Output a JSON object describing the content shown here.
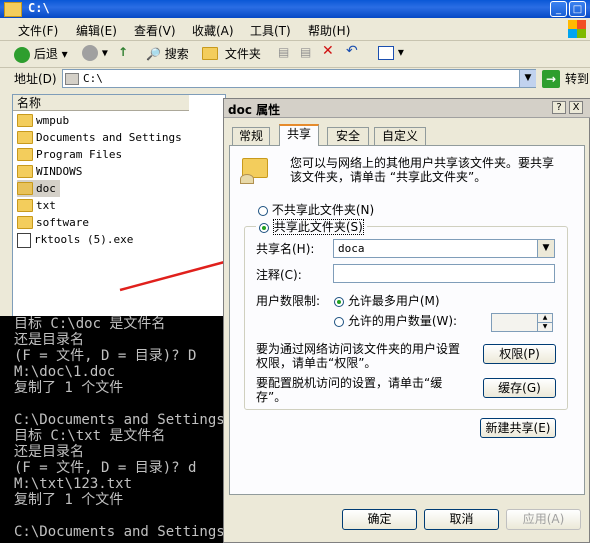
{
  "explorer": {
    "title": "C:\\",
    "menu": [
      "文件(F)",
      "编辑(E)",
      "查看(V)",
      "收藏(A)",
      "工具(T)",
      "帮助(H)"
    ],
    "toolbar": {
      "back": "后退",
      "search": "搜索",
      "folders": "文件夹"
    },
    "address": {
      "label": "地址(D)",
      "value": "C:\\",
      "go": "转到"
    },
    "list_header": "名称",
    "files": [
      "wmpub",
      "Documents and Settings",
      "Program Files",
      "WINDOWS",
      "doc",
      "txt",
      "software",
      "rktools (5).exe"
    ]
  },
  "console": {
    "lines": [
      "目标 C:\\doc 是文件名",
      "还是目录名",
      "(F = 文件, D = 目录)? D",
      "M:\\doc\\1.doc",
      "复制了 1 个文件",
      "",
      "C:\\Documents and Settings\\",
      "目标 C:\\txt 是文件名",
      "还是目录名",
      "(F = 文件, D = 目录)? d",
      "M:\\txt\\123.txt",
      "复制了 1 个文件",
      "",
      "C:\\Documents and Settings\\"
    ]
  },
  "dialog": {
    "title": "doc 属性",
    "help": "?",
    "close": "X",
    "tabs": [
      "常规",
      "共享",
      "安全",
      "自定义"
    ],
    "intro": [
      "您可以与网络上的其他用户共享该文件夹。要共享",
      "该文件夹，请单击 “共享此文件夹”。"
    ],
    "no_share": "不共享此文件夹(N)",
    "share": "共享此文件夹(S)",
    "share_name_label": "共享名(H):",
    "share_name_value": "doca",
    "comment_label": "注释(C):",
    "user_limit_label": "用户数限制:",
    "max_users": "允许最多用户(M)",
    "allowed_users": "允许的用户数量(W):",
    "perm_text": [
      "要为通过网络访问该文件夹的用户设置",
      "权限，请单击“权限”。"
    ],
    "perm_button": "权限(P)",
    "cache_text": [
      "要配置脱机访问的设置，请单击“缓",
      "存”。"
    ],
    "cache_button": "缓存(G)",
    "new_share_button": "新建共享(E)",
    "ok": "确定",
    "cancel": "取消",
    "apply": "应用(A)"
  },
  "colors": {
    "arrow": "#e0201c",
    "titlebar": "#0a58d6",
    "tab_highlight": "#e68b2c"
  }
}
